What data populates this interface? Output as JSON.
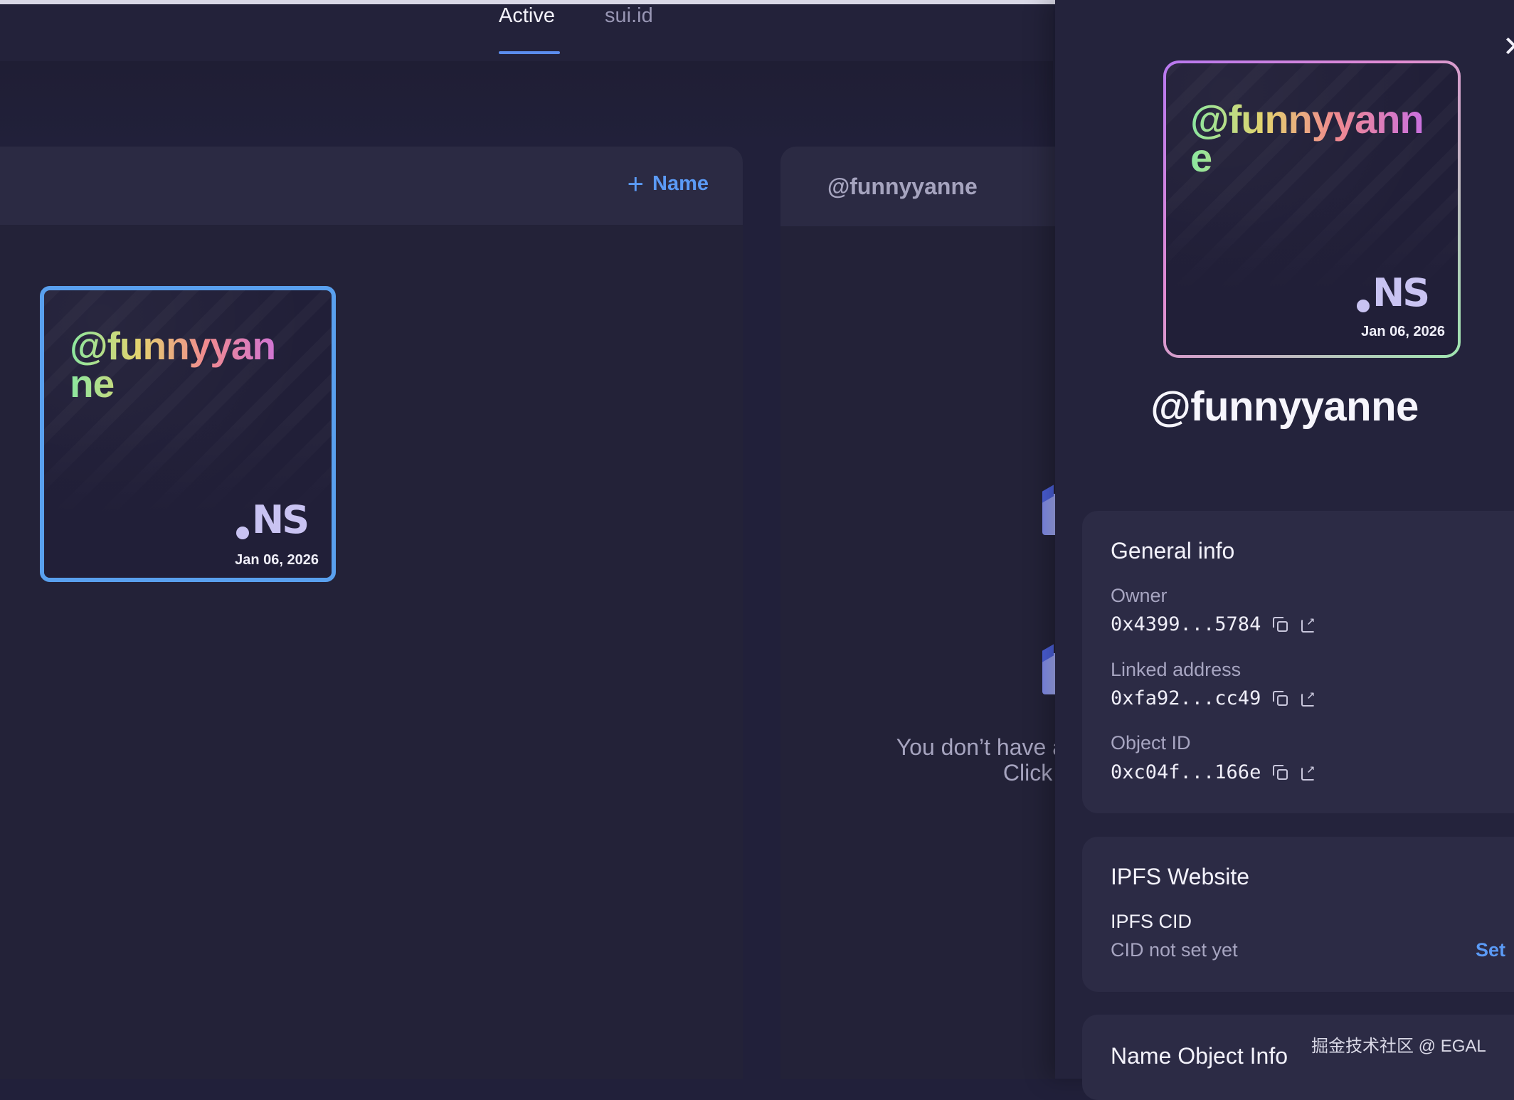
{
  "tabs": {
    "active": "Active",
    "inactive": "sui.id"
  },
  "left_panel": {
    "add_label": "Name",
    "card": {
      "name": "@funnyyanne",
      "date": "Jan 06, 2026",
      "logo_text": "NS"
    }
  },
  "mid_panel": {
    "title": "@funnyyanne",
    "empty_line1": "You don’t have a",
    "empty_line2": "Click t"
  },
  "drawer": {
    "card": {
      "name": "@funnyyanne",
      "date": "Jan 06, 2026",
      "logo_text": "NS"
    },
    "title": "@funnyyanne",
    "general": {
      "title": "General info",
      "owner_label": "Owner",
      "owner_value": "0x4399...5784",
      "linked_label": "Linked address",
      "linked_value": "0xfa92...cc49",
      "object_label": "Object ID",
      "object_value": "0xc04f...166e"
    },
    "ipfs": {
      "title": "IPFS Website",
      "cid_label": "IPFS CID",
      "cid_value": "CID not set yet",
      "set_label": "Set"
    },
    "object_info_title": "Name Object Info"
  },
  "watermark": "掘金技术社区 @ EGAL",
  "colors": {
    "accent": "#5b9af5",
    "background": "#21203a",
    "card_border": "#59a0ee"
  }
}
